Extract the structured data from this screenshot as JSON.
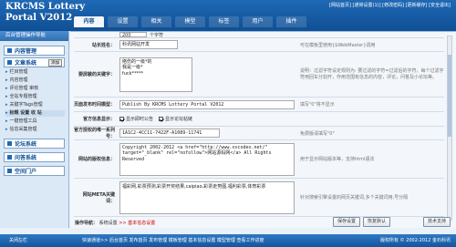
{
  "app": {
    "logo_line1": "KRCMS Lottery",
    "logo_line2": "Portal V2012",
    "toplinks": "[网站首页] [通常设置(1)] [修改密码] [更新缓存] [安全退出]"
  },
  "tabs": [
    "内容",
    "设置",
    "相关",
    "模型",
    "标签",
    "用户",
    "插件"
  ],
  "sidebar": {
    "header": "后台管理操作导航",
    "groups": [
      {
        "label": "内容管理"
      },
      {
        "label": "文章系统",
        "badge": "添加"
      },
      {
        "label": "论坛系统"
      },
      {
        "label": "问答系统"
      },
      {
        "label": "空间门户"
      }
    ],
    "items": [
      "栏目管理",
      "内容管理",
      "评论管理 审核",
      "全站专题管理",
      "关键字Tags管理",
      "标题 设置 收 站",
      "一键管理工具",
      "信息采集管理"
    ]
  },
  "form": {
    "top_value": "200",
    "top_hint": "个字符",
    "site_name_label": "站长姓名：",
    "site_name_value": "科讯网站开发",
    "site_name_hint": "可在模板里使用{$WebMaster}调用",
    "filter_label": "要屏蔽的关键字：",
    "filter_value": "络伤的一级*的\n我是一级*\nfuck*****",
    "filter_hint": "说明：过滤字符设定规则为: 要过滤的字符=过滤后的字符，每个过滤字符用回车分割开，作用范围有信息的内容，评论，问答及小论坛等。",
    "footer_label": "页面发布时间模型：",
    "footer_value": "Publish By KRCMS Lottery Portal V2012",
    "footer_hint": "填写\"0\"将不显示",
    "notice_label": "官方信息显示：",
    "notice_opt1": "显示即时公告",
    "notice_opt2": "显示论坛帖链",
    "serial_label": "官方授权的唯一系列号：",
    "serial_value": "1A1C2-4CC11-7422F-A1089-11741",
    "serial_hint": "免费版请填写\"0\"",
    "copyright_label": "网站的版权信息：",
    "copyright_value": "Copyright 2002-2012 <a href=\"http://www.xxcodex.net/\" target=\"_blank\" rel=\"nofollow\">网站源码网</a> All Rights Reserved",
    "copyright_hint": "用于显示网站版本等，支持html语法",
    "meta_label": "网站META关键词：",
    "meta_value": "福彩网,彩票预测,彩票开奖结果,caipiao,彩票走势图,福利彩票,体育彩票",
    "meta_hint": "针对搜索引擎设置的网页关键词,多个关键词用,号分隔"
  },
  "opbar": {
    "prefix": "操作导航：",
    "link1": "系统设置",
    "sep": ">>",
    "link2": "基本信息设置",
    "btn_save": "保存设置",
    "btn_reset": "恢复默认",
    "btn_help": "技术支持"
  },
  "footer": {
    "left": "关闭左栏",
    "links": "快速通道>> 后台首页 发布首页 发布管理 模板管理 基本信息设置 模型管理 查看工作进度",
    "right": "版权所有 © 2002-2012 金石科讯"
  }
}
